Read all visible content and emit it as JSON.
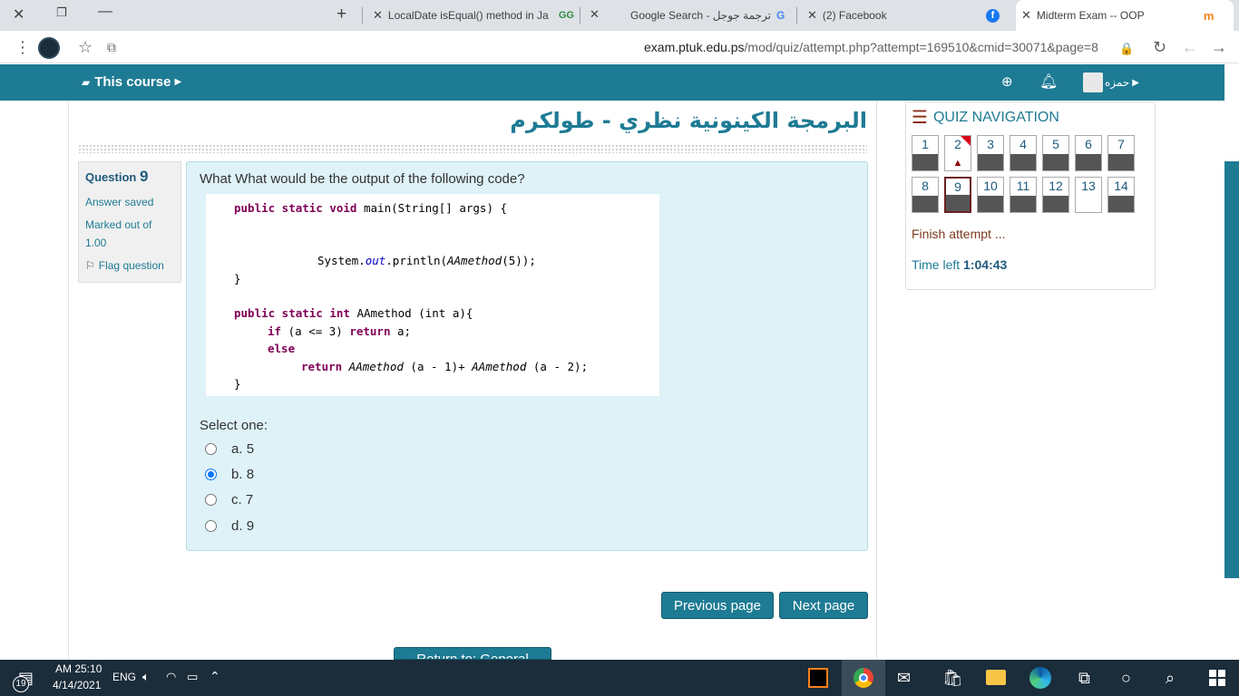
{
  "browser": {
    "tabs": [
      {
        "label": "LocalDate isEqual() method in Ja"
      },
      {
        "label": "Google Search - ترجمة جوجل"
      },
      {
        "label": "(2) Facebook"
      },
      {
        "label": "Midterm Exam -- OOP"
      }
    ],
    "url_domain": "exam.ptuk.edu.ps",
    "url_path": "/mod/quiz/attempt.php?attempt=169510&cmid=30071&page=8"
  },
  "navbar": {
    "this_course": "This course",
    "user_name": "حمزه"
  },
  "course": {
    "title": "البرمجة الكينونية نظري - طولكرم"
  },
  "question": {
    "label": "Question",
    "number": "9",
    "status": "Answer saved",
    "marked": "Marked out of 1.00",
    "flag": "Flag question",
    "text": "What What would be the output of the following code?",
    "select_one": "Select one:",
    "options": [
      {
        "letter": "a.",
        "value": "5",
        "checked": false
      },
      {
        "letter": "b.",
        "value": "8",
        "checked": true
      },
      {
        "letter": "c.",
        "value": "7",
        "checked": false
      },
      {
        "letter": "d.",
        "value": "9",
        "checked": false
      }
    ]
  },
  "code": {
    "l1_kw": "public static void",
    "l1_rest": " main(String[] args) {",
    "l2_a": "System.",
    "l2_out": "out",
    "l2_b": ".println(",
    "l2_call": "AAmethod",
    "l2_c": "(5));",
    "close": "}",
    "l3_kw": "public static int",
    "l3_rest": " AAmethod (int a){",
    "l4_if": "if",
    "l4_mid": " (a <= 3) ",
    "l4_ret": "return",
    "l4_end": " a;",
    "l5_else": "else",
    "l6_ret": "return",
    "l6_a": " AAmethod",
    "l6_b": " (a - 1)+ ",
    "l6_c": "AAmethod",
    "l6_d": " (a - 2);"
  },
  "buttons": {
    "previous": "Previous page",
    "next": "Next page",
    "return": "Return to: General"
  },
  "quiz_nav": {
    "title": "QUIZ NAVIGATION",
    "items": [
      "1",
      "2",
      "3",
      "4",
      "5",
      "6",
      "7",
      "8",
      "9",
      "10",
      "11",
      "12",
      "13",
      "14"
    ],
    "finish": "Finish attempt ...",
    "time_label": "Time left",
    "time_value": "1:04:43"
  },
  "taskbar": {
    "time": "AM 25:10",
    "date": "4/14/2021",
    "lang": "ENG",
    "notif_count": "19"
  },
  "colors": {
    "brand": "#1e7b94",
    "question_bg": "#def2f8",
    "flagged": "#d9001b"
  }
}
